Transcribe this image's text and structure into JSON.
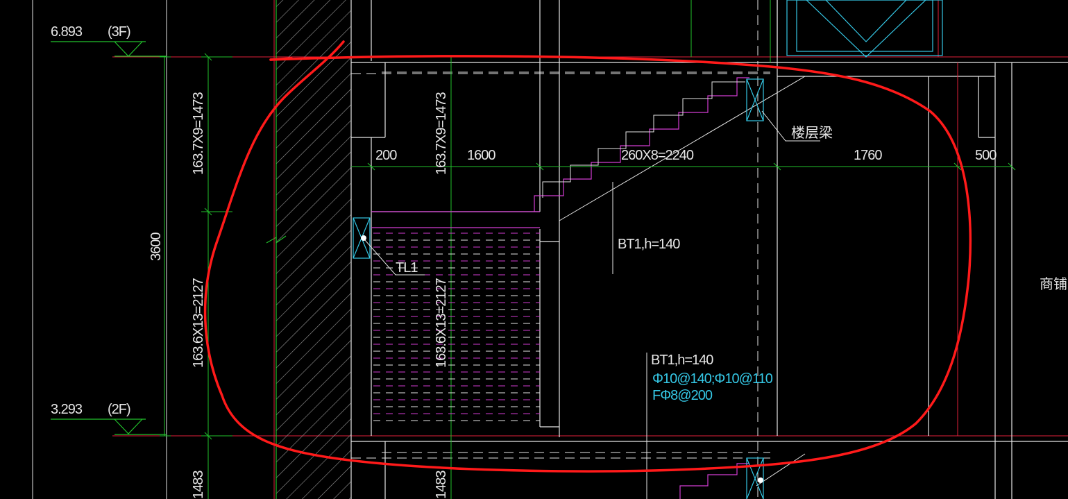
{
  "levels": {
    "upper": {
      "elevation": "6.893",
      "floor": "(3F)"
    },
    "lower": {
      "elevation": "3.293",
      "floor": "(2F)"
    }
  },
  "dims": {
    "floor_height": "3600",
    "upper_flight": "163.7X9=1473",
    "lower_flight": "163.6X13=2127",
    "inner_upper_flight": "163.7X9=1473",
    "inner_lower_flight": "163.6X13=2127",
    "bottom_left": "1483",
    "bottom_mid": "1483",
    "plan_200": "200",
    "plan_1600": "1600",
    "plan_treads": "260X8=2240",
    "plan_1760": "1760",
    "plan_500": "500"
  },
  "labels": {
    "floor_beam": "楼层梁",
    "tl1": "TL1",
    "bt1_a": "BT1,h=140",
    "bt1_b": "BT1,h=140",
    "rebar1": "Φ10@140;Φ10@110",
    "rebar2": "FΦ8@200",
    "shop": "商铺"
  },
  "colors": {
    "background": "#000000",
    "line": "#e6e6e6",
    "dim_green": "#22c22c",
    "axis_red": "#e0203a",
    "step_magenta": "#d23cd2",
    "cyan": "#35c8e6",
    "markup_red": "#ff1a1a"
  }
}
